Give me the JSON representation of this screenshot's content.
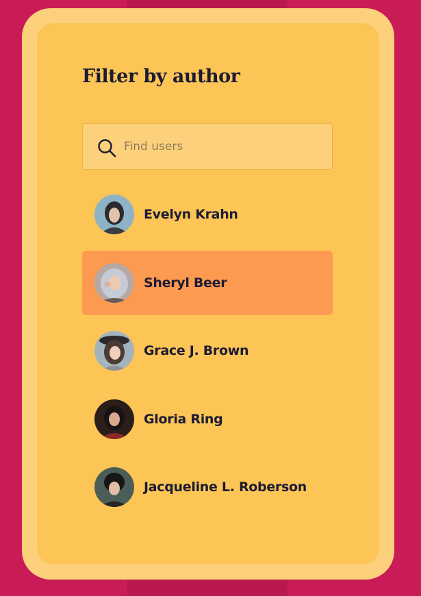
{
  "panel": {
    "title": "Filter by author"
  },
  "search": {
    "placeholder": "Find users",
    "value": "",
    "icon": "search-icon"
  },
  "users": [
    {
      "name": "Evelyn Krahn",
      "selected": false
    },
    {
      "name": "Sheryl Beer",
      "selected": true
    },
    {
      "name": "Grace J. Brown",
      "selected": false
    },
    {
      "name": "Gloria Ring",
      "selected": false
    },
    {
      "name": "Jacqueline L. Roberson",
      "selected": false
    }
  ],
  "colors": {
    "page_background": "#c91c57",
    "card_border": "#fdd17b",
    "card_background": "#fcc555",
    "selected_row": "#fd9a51",
    "text": "#1c1b33"
  }
}
